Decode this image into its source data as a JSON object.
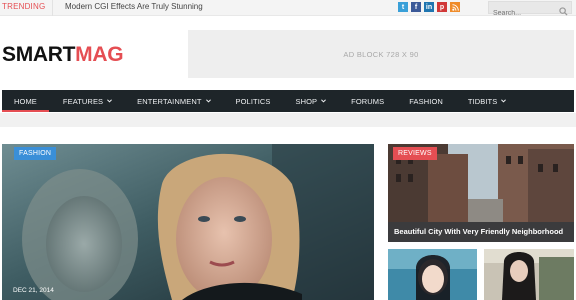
{
  "topbar": {
    "trending_label": "TRENDING",
    "trending_text": "Modern CGI Effects Are Truly Stunning",
    "social": [
      {
        "name": "twitter-icon",
        "glyph": "t",
        "color": "#3aa0d8"
      },
      {
        "name": "facebook-icon",
        "glyph": "f",
        "color": "#3b5998"
      },
      {
        "name": "linkedin-icon",
        "glyph": "in",
        "color": "#1f75b0"
      },
      {
        "name": "pinterest-icon",
        "glyph": "p",
        "color": "#d13838"
      },
      {
        "name": "rss-icon",
        "glyph": "r",
        "color": "#ef8c2a"
      }
    ],
    "search_placeholder": "Search..."
  },
  "header": {
    "logo_part1": "SMART",
    "logo_part2": "MAG",
    "ad_text": "AD BLOCK  728 X 90"
  },
  "nav": {
    "items": [
      {
        "label": "HOME",
        "active": true,
        "dropdown": false
      },
      {
        "label": "FEATURES",
        "active": false,
        "dropdown": true
      },
      {
        "label": "ENTERTAINMENT",
        "active": false,
        "dropdown": true
      },
      {
        "label": "POLITICS",
        "active": false,
        "dropdown": false
      },
      {
        "label": "SHOP",
        "active": false,
        "dropdown": true
      },
      {
        "label": "FORUMS",
        "active": false,
        "dropdown": false
      },
      {
        "label": "FASHION",
        "active": false,
        "dropdown": false
      },
      {
        "label": "TIDBITS",
        "active": false,
        "dropdown": true
      }
    ]
  },
  "content": {
    "featured": {
      "category": "FASHION",
      "date": "DEC 21, 2014"
    },
    "side_top": {
      "category": "REVIEWS",
      "title": "Beautiful City With Very Friendly Neighborhood"
    }
  },
  "colors": {
    "accent": "#e54e53",
    "nav_bg": "#1e2529",
    "fashion_badge": "#3a8fd8"
  }
}
